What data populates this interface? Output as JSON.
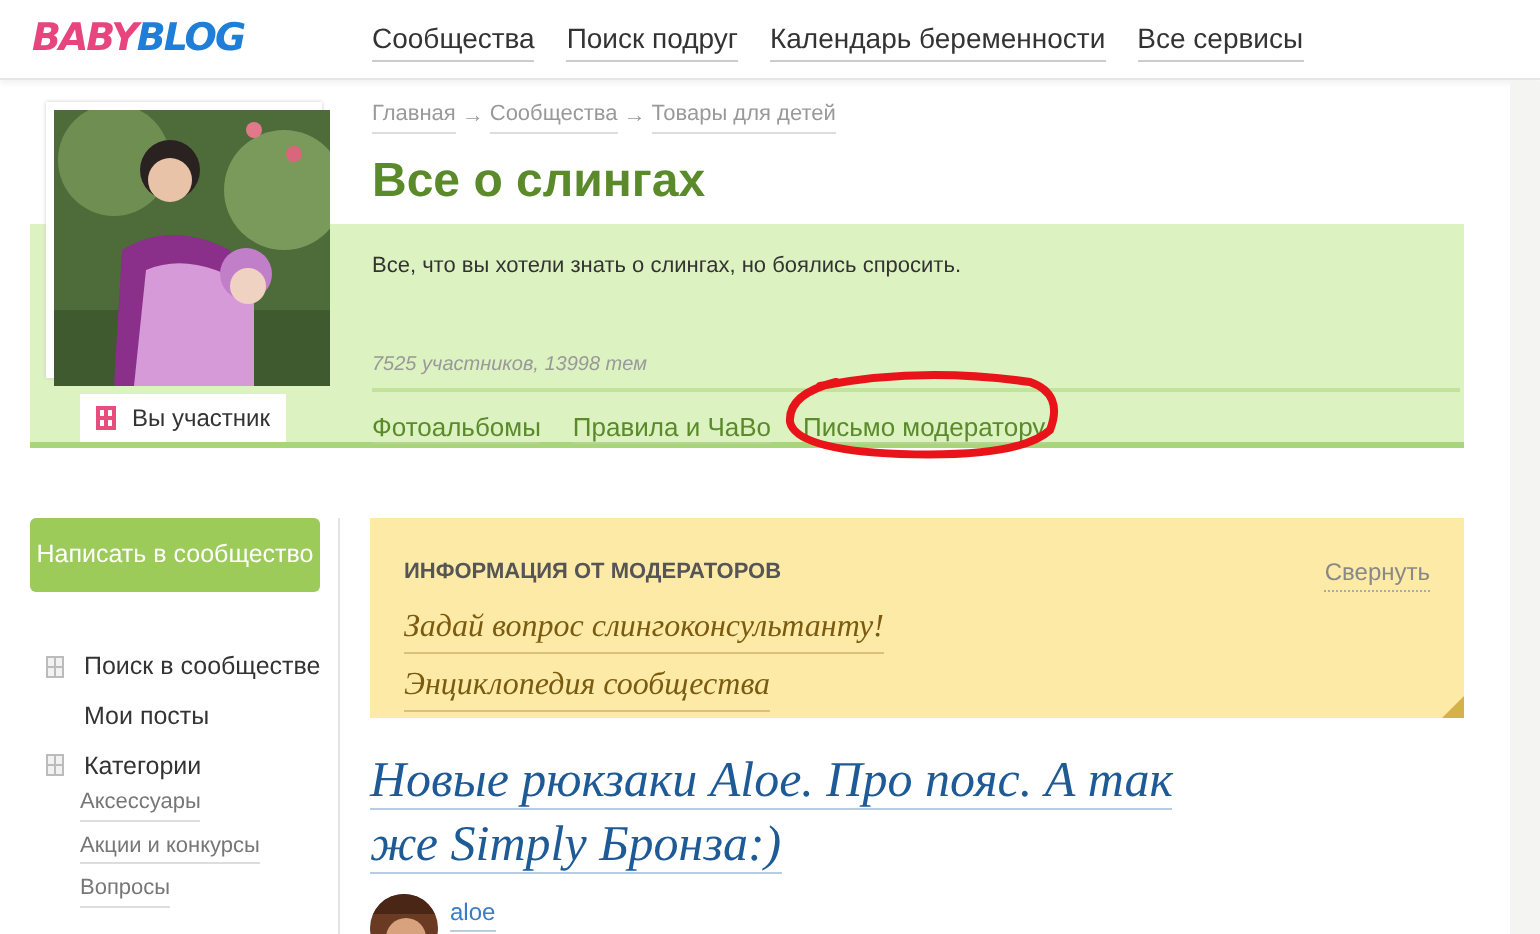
{
  "header": {
    "logo": {
      "part1": "BABY",
      "part2": "BLOG"
    },
    "nav": [
      {
        "label": "Сообщества"
      },
      {
        "label": "Поиск подруг"
      },
      {
        "label": "Календарь беременности"
      },
      {
        "label": "Все сервисы"
      }
    ]
  },
  "community": {
    "member_button": "Вы участник",
    "breadcrumbs": [
      {
        "label": "Главная"
      },
      {
        "label": "Сообщества"
      },
      {
        "label": "Товары для детей"
      }
    ],
    "separators": [
      "→",
      "→"
    ],
    "title": "Все о слингах",
    "description": "Все, что вы хотели знать о слингах, но боялись спросить.",
    "stats": "7525 участников, 13998 тем",
    "tabs": [
      {
        "label": "Фотоальбомы",
        "circled": false
      },
      {
        "label": "Правила и ЧаВо",
        "circled": false
      },
      {
        "label": "Письмо модератору",
        "circled": true
      }
    ]
  },
  "sidebar": {
    "write_button": "Написать в сообщество",
    "items": [
      {
        "label": "Поиск в сообществе",
        "icon": true
      },
      {
        "label": "Мои посты",
        "icon": false
      },
      {
        "label": "Категории",
        "icon": true,
        "children": [
          {
            "label": "Аксессуары"
          },
          {
            "label": "Акции и конкурсы"
          },
          {
            "label": "Вопросы"
          }
        ]
      }
    ]
  },
  "moderator_info": {
    "heading": "ИНФОРМАЦИЯ ОТ МОДЕРАТОРОВ",
    "collapse": "Свернуть",
    "links": [
      {
        "label": "Задай вопрос слингоконсультанту!"
      },
      {
        "label": "Энциклопедия сообщества"
      }
    ]
  },
  "post": {
    "title": "Новые рюкзаки Aloe. Про пояс. А так же Simply Бронза:)",
    "author": "aloe"
  }
}
